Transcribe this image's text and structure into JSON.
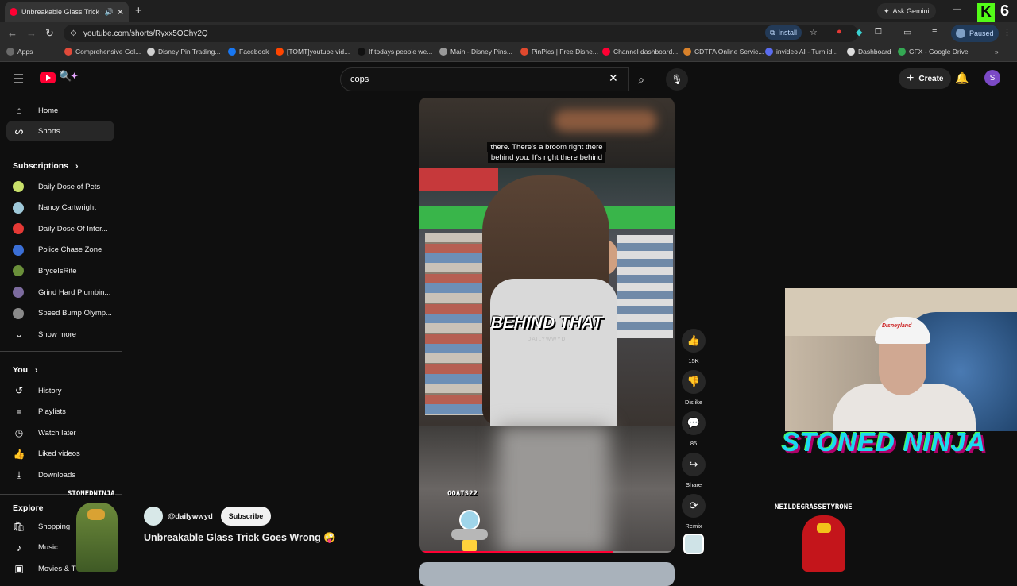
{
  "browser": {
    "tab_title": "Unbreakable Glass Trick Go...",
    "url": "youtube.com/shorts/Ryxx5OChy2Q",
    "install_label": "Install",
    "profile_label": "Paused",
    "gemini_label": "Ask Gemini",
    "kick_viewers": "6"
  },
  "bookmarks": [
    {
      "label": "Apps",
      "color": "#6a6a6a"
    },
    {
      "label": "Comprehensive Gol...",
      "color": "#e04a3a"
    },
    {
      "label": "Disney Pin Trading...",
      "color": "#cfcfcf"
    },
    {
      "label": "Facebook",
      "color": "#1877f2"
    },
    {
      "label": "[TOMT]youtube vid...",
      "color": "#ff4500"
    },
    {
      "label": "If todays people we...",
      "color": "#111111"
    },
    {
      "label": "Main - Disney Pins...",
      "color": "#999999"
    },
    {
      "label": "PinPics | Free Disne...",
      "color": "#e0492e"
    },
    {
      "label": "Channel dashboard...",
      "color": "#ff0033"
    },
    {
      "label": "CDTFA Online Servic...",
      "color": "#d9822b"
    },
    {
      "label": "invideo AI - Turn id...",
      "color": "#5a6cf0"
    },
    {
      "label": "Dashboard",
      "color": "#dddddd"
    },
    {
      "label": "GFX - Google Drive",
      "color": "#34a853"
    }
  ],
  "search": {
    "query": "cops"
  },
  "header": {
    "create_label": "Create",
    "avatar_letter": "S"
  },
  "sidebar": {
    "home": "Home",
    "shorts": "Shorts",
    "subscriptions_heading": "Subscriptions",
    "subscriptions": [
      {
        "label": "Daily Dose of Pets",
        "color": "#c8e06a"
      },
      {
        "label": "Nancy Cartwright",
        "color": "#9ec8d8"
      },
      {
        "label": "Daily Dose Of Inter...",
        "color": "#e53935"
      },
      {
        "label": "Police Chase Zone",
        "color": "#3b6fd6"
      },
      {
        "label": "BryceIsRite",
        "color": "#6a8f3a"
      },
      {
        "label": "Grind Hard Plumbin...",
        "color": "#7c6b9e"
      },
      {
        "label": "Speed Bump Olymp...",
        "color": "#8a8a8a"
      }
    ],
    "show_more": "Show more",
    "you_heading": "You",
    "you_items": [
      "History",
      "Playlists",
      "Watch later",
      "Liked videos",
      "Downloads"
    ],
    "explore_heading": "Explore",
    "explore_items": [
      "Shopping",
      "Music",
      "Movies & TV"
    ]
  },
  "video": {
    "caption_line1": "there. There's a broom right there",
    "caption_line2": "behind you. It's right there behind",
    "big_caption": "BEHIND THAT",
    "watermark": "DAILYWWYD",
    "progress": 0.76,
    "channel_handle": "@dailywwyd",
    "subscribe_label": "Subscribe",
    "title": "Unbreakable Glass Trick Goes Wrong 🤪"
  },
  "actions": {
    "likes": "15K",
    "dislike_label": "Dislike",
    "comments": "85",
    "share_label": "Share",
    "remix_label": "Remix"
  },
  "overlay": {
    "webcam_cap_text": "Disneyland",
    "streamer_banner": "STONED NINJA",
    "sprite_left": "STONEDNINJA",
    "sprite_video": "GOATS22",
    "sprite_right": "NEILDEGRASSETYRONE"
  }
}
